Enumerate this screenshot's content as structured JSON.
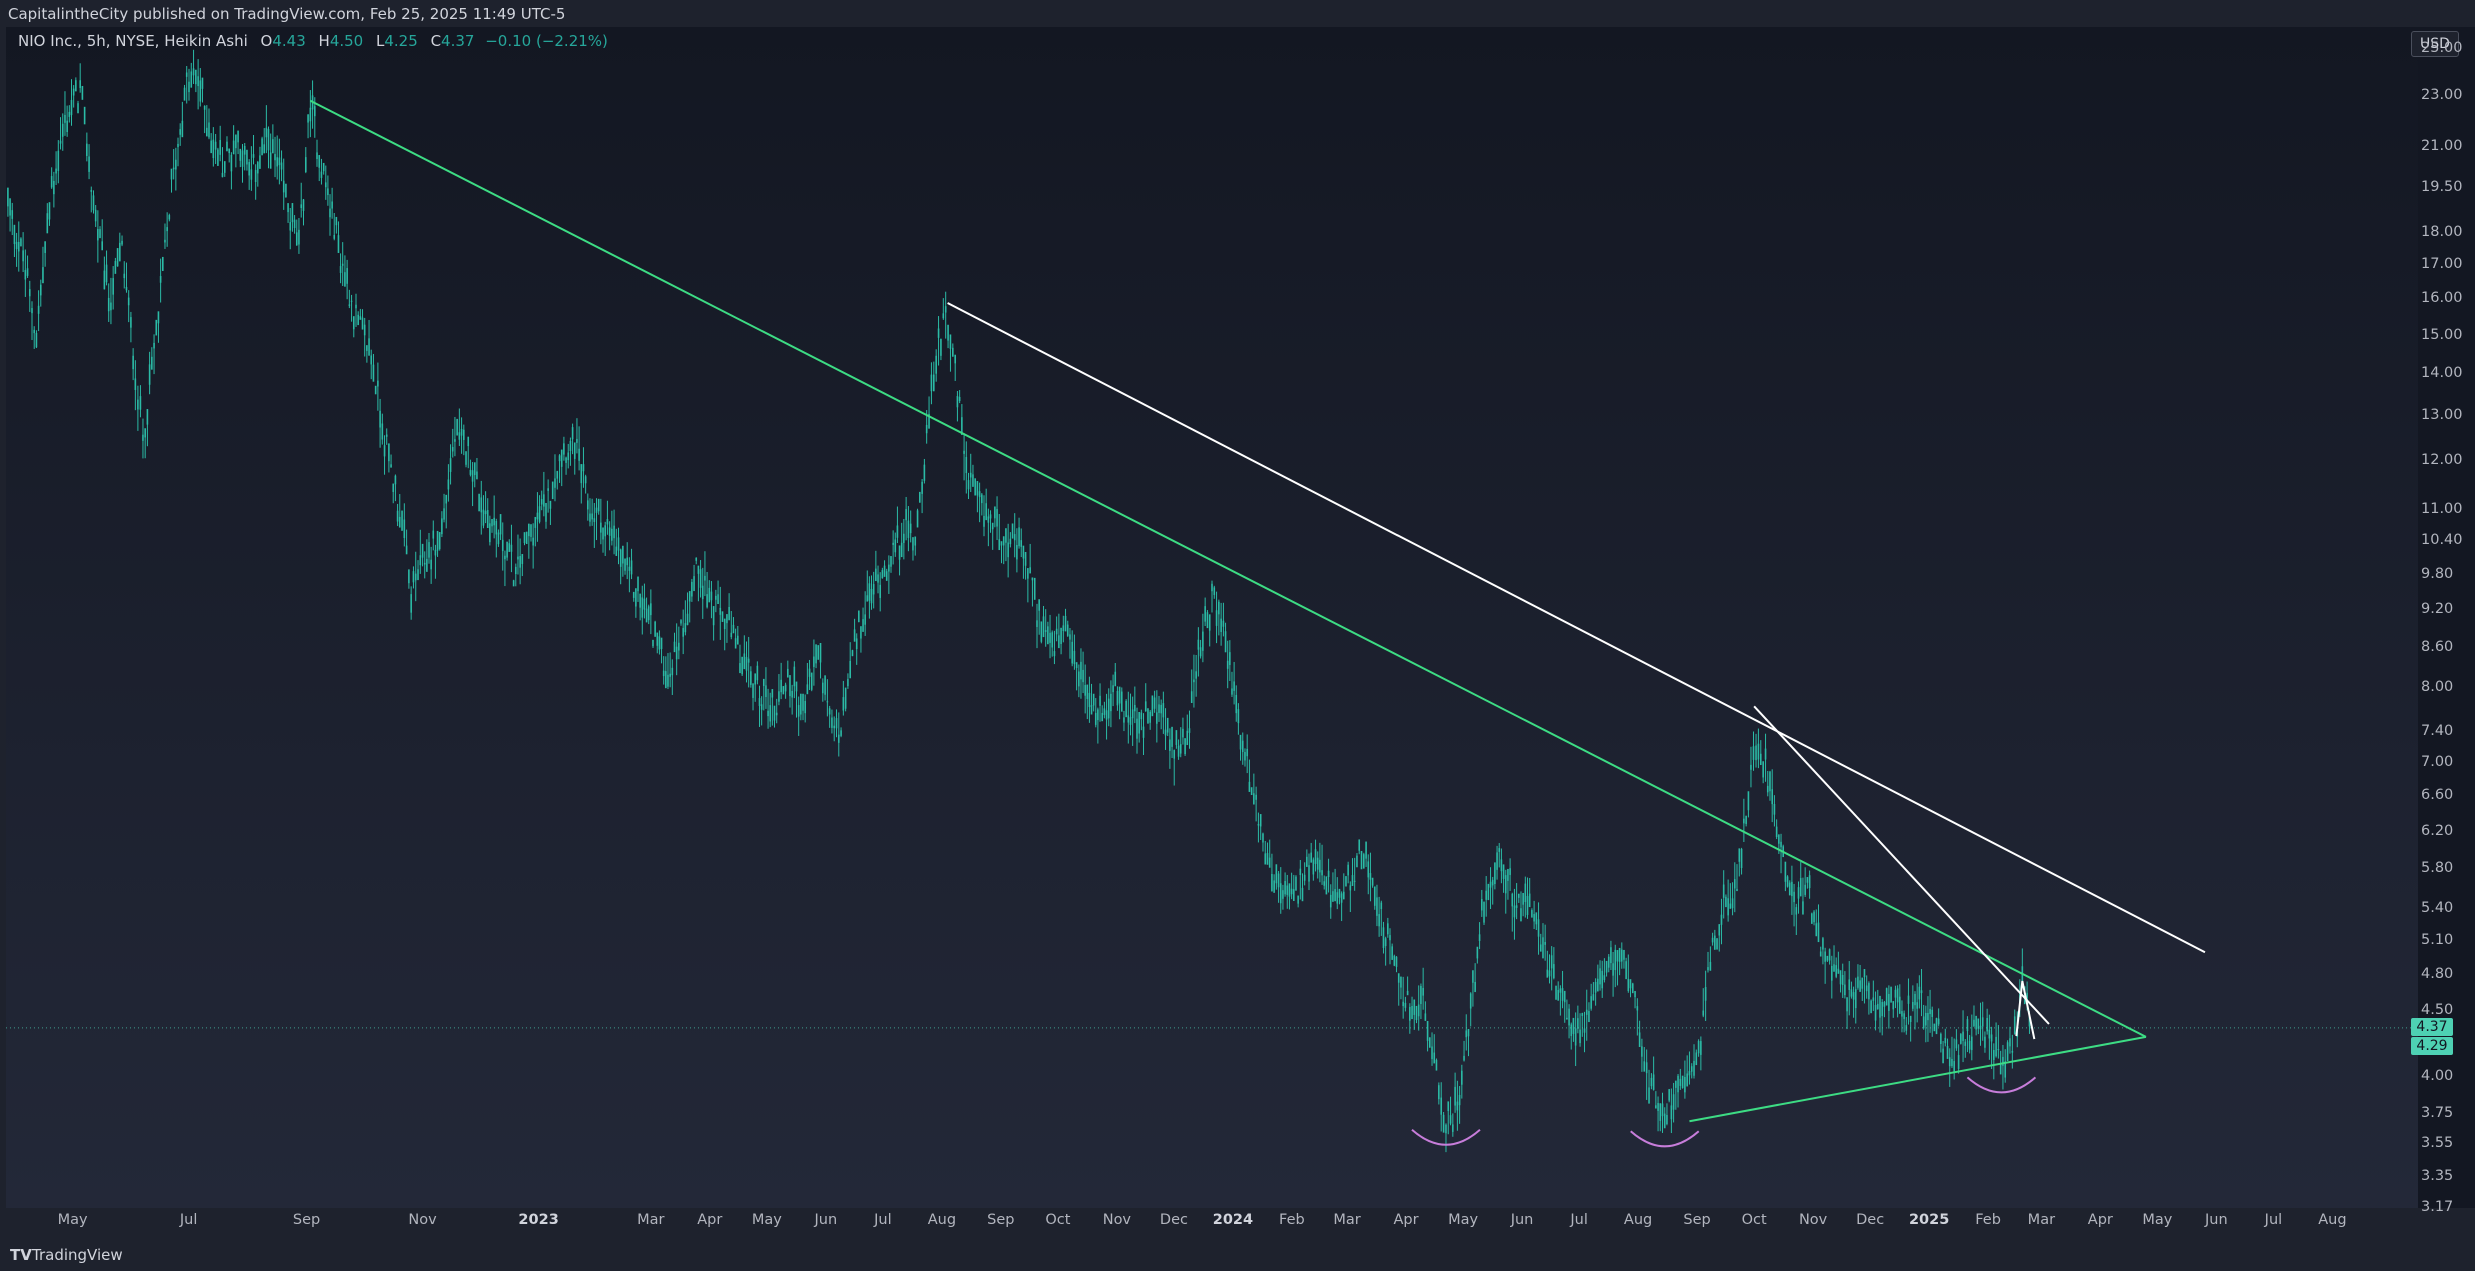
{
  "header": {
    "publisher_text": "CapitalintheCity published on TradingView.com, Feb 25, 2025 11:49 UTC-5"
  },
  "legend": {
    "symbol_text": "NIO Inc., 5h, NYSE, Heikin Ashi",
    "o_label": "O",
    "o_value": "4.43",
    "h_label": "H",
    "h_value": "4.50",
    "l_label": "L",
    "l_value": "4.25",
    "c_label": "C",
    "c_value": "4.37",
    "change_text": "−0.10 (−2.21%)"
  },
  "footer": {
    "brand_text": "TradingView",
    "logo_glyph": "TV"
  },
  "price_axis": {
    "currency_label": "USD",
    "ticks": [
      "25.00",
      "23.00",
      "21.00",
      "19.50",
      "18.00",
      "17.00",
      "16.00",
      "15.00",
      "14.00",
      "13.00",
      "12.00",
      "11.00",
      "10.40",
      "9.80",
      "9.20",
      "8.60",
      "8.00",
      "7.40",
      "7.00",
      "6.60",
      "6.20",
      "5.80",
      "5.40",
      "5.10",
      "4.80",
      "4.50",
      "4.00",
      "3.75",
      "3.55",
      "3.35",
      "3.17"
    ],
    "current_price_tag": "4.37",
    "second_price_tag": "4.29"
  },
  "colors": {
    "background_top": "#131722",
    "background_bottom": "#232838",
    "candles": "#2bbba6",
    "trendline_green": "#3ddc84",
    "trendline_white": "#ffffff",
    "arc_purple": "#c77dda",
    "price_tag": "#4ed1b3"
  },
  "chart_data": {
    "type": "candlestick",
    "symbol": "NIO Inc.",
    "interval": "5h",
    "exchange": "NYSE",
    "style": "Heikin Ashi",
    "y_scale": "log",
    "ylim": [
      3.17,
      26.0
    ],
    "xlim": [
      "2022-03-27",
      "2025-09-15"
    ],
    "x_ticks": [
      {
        "label": "May",
        "date": "2022-05-01",
        "bold": false
      },
      {
        "label": "Jul",
        "date": "2022-07-01",
        "bold": false
      },
      {
        "label": "Sep",
        "date": "2022-09-01",
        "bold": false
      },
      {
        "label": "Nov",
        "date": "2022-11-01",
        "bold": false
      },
      {
        "label": "2023",
        "date": "2023-01-01",
        "bold": true
      },
      {
        "label": "Mar",
        "date": "2023-03-01",
        "bold": false
      },
      {
        "label": "Apr",
        "date": "2023-04-01",
        "bold": false
      },
      {
        "label": "May",
        "date": "2023-05-01",
        "bold": false
      },
      {
        "label": "Jun",
        "date": "2023-06-01",
        "bold": false
      },
      {
        "label": "Jul",
        "date": "2023-07-01",
        "bold": false
      },
      {
        "label": "Aug",
        "date": "2023-08-01",
        "bold": false
      },
      {
        "label": "Sep",
        "date": "2023-09-01",
        "bold": false
      },
      {
        "label": "Oct",
        "date": "2023-10-01",
        "bold": false
      },
      {
        "label": "Nov",
        "date": "2023-11-01",
        "bold": false
      },
      {
        "label": "Dec",
        "date": "2023-12-01",
        "bold": false
      },
      {
        "label": "2024",
        "date": "2024-01-01",
        "bold": true
      },
      {
        "label": "Feb",
        "date": "2024-02-01",
        "bold": false
      },
      {
        "label": "Mar",
        "date": "2024-03-01",
        "bold": false
      },
      {
        "label": "Apr",
        "date": "2024-04-01",
        "bold": false
      },
      {
        "label": "May",
        "date": "2024-05-01",
        "bold": false
      },
      {
        "label": "Jun",
        "date": "2024-06-01",
        "bold": false
      },
      {
        "label": "Jul",
        "date": "2024-07-01",
        "bold": false
      },
      {
        "label": "Aug",
        "date": "2024-08-01",
        "bold": false
      },
      {
        "label": "Sep",
        "date": "2024-09-01",
        "bold": false
      },
      {
        "label": "Oct",
        "date": "2024-10-01",
        "bold": false
      },
      {
        "label": "Nov",
        "date": "2024-11-01",
        "bold": false
      },
      {
        "label": "Dec",
        "date": "2024-12-01",
        "bold": false
      },
      {
        "label": "2025",
        "date": "2025-01-01",
        "bold": true
      },
      {
        "label": "Feb",
        "date": "2025-02-01",
        "bold": false
      },
      {
        "label": "Mar",
        "date": "2025-03-01",
        "bold": false
      },
      {
        "label": "Apr",
        "date": "2025-04-01",
        "bold": false
      },
      {
        "label": "May",
        "date": "2025-05-01",
        "bold": false
      },
      {
        "label": "Jun",
        "date": "2025-06-01",
        "bold": false
      },
      {
        "label": "Jul",
        "date": "2025-07-01",
        "bold": false
      },
      {
        "label": "Aug",
        "date": "2025-08-01",
        "bold": false
      }
    ],
    "price_path": [
      [
        "2022-03-28",
        19.0
      ],
      [
        "2022-04-05",
        17.2
      ],
      [
        "2022-04-12",
        15.0
      ],
      [
        "2022-04-20",
        19.5
      ],
      [
        "2022-04-27",
        22.0
      ],
      [
        "2022-05-05",
        23.3
      ],
      [
        "2022-05-12",
        19.0
      ],
      [
        "2022-05-20",
        16.0
      ],
      [
        "2022-05-27",
        17.5
      ],
      [
        "2022-06-03",
        14.0
      ],
      [
        "2022-06-07",
        12.5
      ],
      [
        "2022-06-14",
        15.0
      ],
      [
        "2022-06-22",
        19.5
      ],
      [
        "2022-06-30",
        23.5
      ],
      [
        "2022-07-06",
        23.7
      ],
      [
        "2022-07-14",
        21.0
      ],
      [
        "2022-07-20",
        20.4
      ],
      [
        "2022-07-27",
        21.3
      ],
      [
        "2022-08-03",
        20.0
      ],
      [
        "2022-08-12",
        21.3
      ],
      [
        "2022-08-20",
        19.5
      ],
      [
        "2022-08-28",
        17.5
      ],
      [
        "2022-09-03",
        22.7
      ],
      [
        "2022-09-10",
        20.0
      ],
      [
        "2022-09-20",
        17.0
      ],
      [
        "2022-09-27",
        15.5
      ],
      [
        "2022-10-05",
        14.5
      ],
      [
        "2022-10-12",
        12.5
      ],
      [
        "2022-10-20",
        11.0
      ],
      [
        "2022-10-26",
        9.5
      ],
      [
        "2022-11-01",
        10.0
      ],
      [
        "2022-11-10",
        10.4
      ],
      [
        "2022-11-18",
        12.5
      ],
      [
        "2022-11-25",
        12.2
      ],
      [
        "2022-12-03",
        11.0
      ],
      [
        "2022-12-12",
        10.5
      ],
      [
        "2022-12-20",
        9.8
      ],
      [
        "2022-12-28",
        10.6
      ],
      [
        "2023-01-06",
        11.2
      ],
      [
        "2023-01-12",
        12.2
      ],
      [
        "2023-01-20",
        12.4
      ],
      [
        "2023-01-28",
        11.0
      ],
      [
        "2023-02-05",
        10.7
      ],
      [
        "2023-02-12",
        10.2
      ],
      [
        "2023-02-20",
        9.6
      ],
      [
        "2023-03-01",
        9.0
      ],
      [
        "2023-03-10",
        8.2
      ],
      [
        "2023-03-18",
        9.0
      ],
      [
        "2023-03-26",
        10.0
      ],
      [
        "2023-04-03",
        9.2
      ],
      [
        "2023-04-10",
        9.0
      ],
      [
        "2023-04-18",
        8.4
      ],
      [
        "2023-04-26",
        8.0
      ],
      [
        "2023-05-05",
        7.7
      ],
      [
        "2023-05-12",
        8.2
      ],
      [
        "2023-05-20",
        7.7
      ],
      [
        "2023-05-28",
        8.6
      ],
      [
        "2023-06-03",
        7.5
      ],
      [
        "2023-06-09",
        7.4
      ],
      [
        "2023-06-15",
        8.5
      ],
      [
        "2023-06-25",
        9.5
      ],
      [
        "2023-07-03",
        10.0
      ],
      [
        "2023-07-12",
        10.6
      ],
      [
        "2023-07-18",
        10.5
      ],
      [
        "2023-07-24",
        12.5
      ],
      [
        "2023-07-29",
        14.5
      ],
      [
        "2023-08-03",
        15.8
      ],
      [
        "2023-08-08",
        14.0
      ],
      [
        "2023-08-15",
        11.5
      ],
      [
        "2023-08-22",
        11.0
      ],
      [
        "2023-08-30",
        10.7
      ],
      [
        "2023-09-06",
        10.4
      ],
      [
        "2023-09-14",
        10.1
      ],
      [
        "2023-09-20",
        9.2
      ],
      [
        "2023-09-28",
        8.6
      ],
      [
        "2023-10-05",
        8.8
      ],
      [
        "2023-10-12",
        8.2
      ],
      [
        "2023-10-22",
        7.6
      ],
      [
        "2023-10-30",
        8.0
      ],
      [
        "2023-11-07",
        7.6
      ],
      [
        "2023-11-15",
        7.5
      ],
      [
        "2023-11-22",
        7.8
      ],
      [
        "2023-11-30",
        7.2
      ],
      [
        "2023-12-08",
        7.4
      ],
      [
        "2023-12-15",
        8.6
      ],
      [
        "2023-12-21",
        9.4
      ],
      [
        "2023-12-27",
        8.9
      ],
      [
        "2024-01-05",
        7.4
      ],
      [
        "2024-01-12",
        6.6
      ],
      [
        "2024-01-18",
        6.0
      ],
      [
        "2024-01-25",
        5.6
      ],
      [
        "2024-02-02",
        5.5
      ],
      [
        "2024-02-10",
        5.8
      ],
      [
        "2024-02-18",
        5.7
      ],
      [
        "2024-02-26",
        5.4
      ],
      [
        "2024-03-05",
        5.8
      ],
      [
        "2024-03-11",
        6.0
      ],
      [
        "2024-03-19",
        5.3
      ],
      [
        "2024-03-27",
        4.8
      ],
      [
        "2024-04-03",
        4.5
      ],
      [
        "2024-04-10",
        4.6
      ],
      [
        "2024-04-17",
        4.0
      ],
      [
        "2024-04-22",
        3.7
      ],
      [
        "2024-04-28",
        3.8
      ],
      [
        "2024-05-05",
        4.5
      ],
      [
        "2024-05-12",
        5.5
      ],
      [
        "2024-05-20",
        5.9
      ],
      [
        "2024-05-28",
        5.5
      ],
      [
        "2024-06-05",
        5.4
      ],
      [
        "2024-06-12",
        5.1
      ],
      [
        "2024-06-20",
        4.6
      ],
      [
        "2024-06-28",
        4.4
      ],
      [
        "2024-07-05",
        4.4
      ],
      [
        "2024-07-12",
        4.7
      ],
      [
        "2024-07-20",
        5.0
      ],
      [
        "2024-07-28",
        4.8
      ],
      [
        "2024-08-03",
        4.2
      ],
      [
        "2024-08-08",
        3.9
      ],
      [
        "2024-08-15",
        3.75
      ],
      [
        "2024-08-22",
        3.95
      ],
      [
        "2024-08-28",
        4.1
      ],
      [
        "2024-09-03",
        4.3
      ],
      [
        "2024-09-08",
        5.0
      ],
      [
        "2024-09-15",
        5.4
      ],
      [
        "2024-09-22",
        5.6
      ],
      [
        "2024-09-28",
        6.6
      ],
      [
        "2024-10-02",
        7.3
      ],
      [
        "2024-10-07",
        7.0
      ],
      [
        "2024-10-14",
        6.2
      ],
      [
        "2024-10-22",
        5.4
      ],
      [
        "2024-10-29",
        5.6
      ],
      [
        "2024-11-05",
        5.1
      ],
      [
        "2024-11-12",
        4.8
      ],
      [
        "2024-11-20",
        4.6
      ],
      [
        "2024-11-28",
        4.7
      ],
      [
        "2024-12-05",
        4.5
      ],
      [
        "2024-12-12",
        4.7
      ],
      [
        "2024-12-20",
        4.5
      ],
      [
        "2024-12-28",
        4.6
      ],
      [
        "2025-01-06",
        4.3
      ],
      [
        "2025-01-13",
        4.1
      ],
      [
        "2025-01-20",
        4.3
      ],
      [
        "2025-01-28",
        4.4
      ],
      [
        "2025-02-04",
        4.2
      ],
      [
        "2025-02-10",
        4.1
      ],
      [
        "2025-02-15",
        4.3
      ],
      [
        "2025-02-19",
        4.7
      ],
      [
        "2025-02-24",
        4.37
      ]
    ],
    "trendlines": [
      {
        "color": "green",
        "from": [
          "2022-09-03",
          22.8
        ],
        "to": [
          "2025-04-25",
          4.3
        ]
      },
      {
        "color": "green",
        "from": [
          "2024-08-28",
          3.7
        ],
        "to": [
          "2025-04-25",
          4.3
        ]
      },
      {
        "color": "white",
        "from": [
          "2023-08-04",
          15.9
        ],
        "to": [
          "2025-05-26",
          5.0
        ]
      },
      {
        "color": "white",
        "from": [
          "2024-10-01",
          7.75
        ],
        "to": [
          "2025-03-05",
          4.4
        ]
      }
    ],
    "arcs": [
      {
        "date": "2024-04-22",
        "price": 3.58
      },
      {
        "date": "2024-08-15",
        "price": 3.57
      },
      {
        "date": "2025-02-08",
        "price": 3.93
      }
    ],
    "current_price": 4.37,
    "second_price": 4.29
  }
}
